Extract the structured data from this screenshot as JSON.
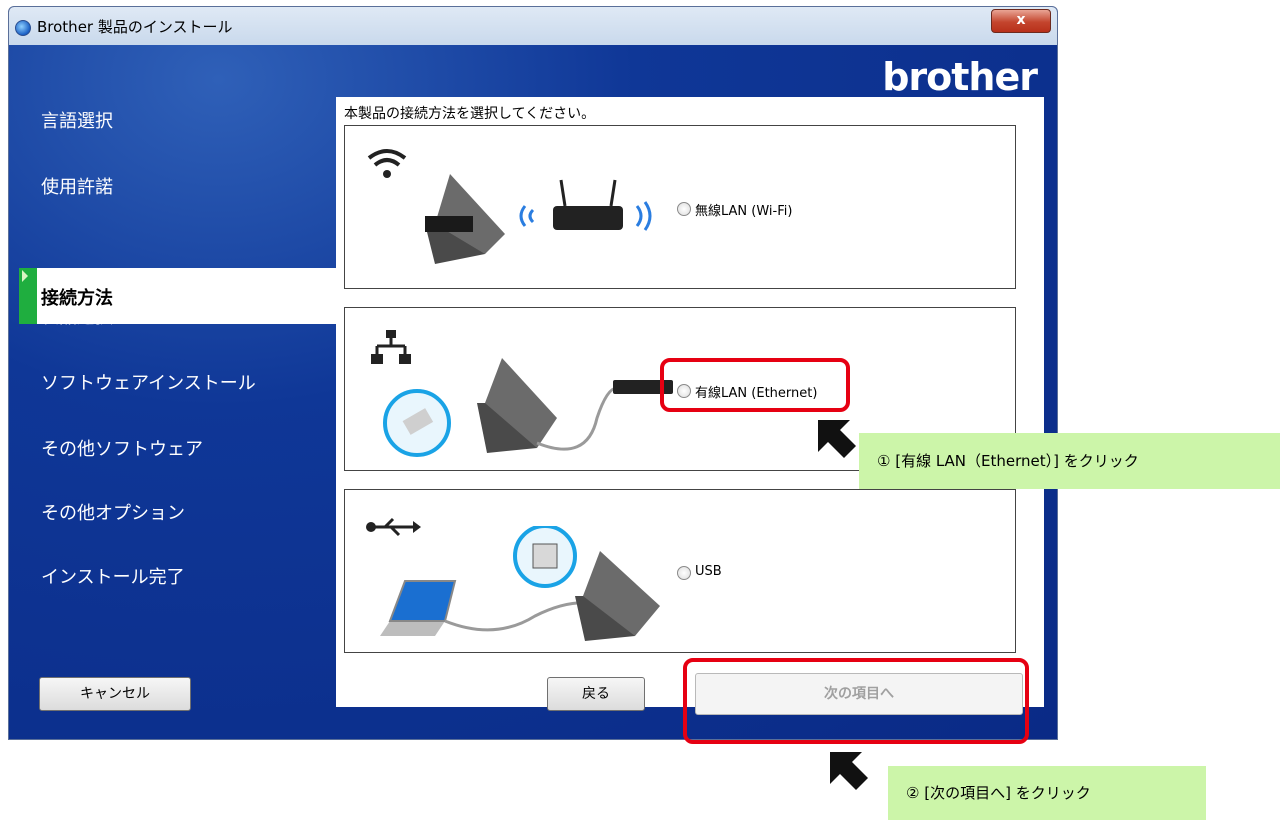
{
  "window": {
    "title": "Brother 製品のインストール",
    "close_label": "x"
  },
  "brand": {
    "logo_text": "brother"
  },
  "sidebar": {
    "items": [
      {
        "label": "言語選択"
      },
      {
        "label": "使用許諾"
      },
      {
        "label": "接続方法",
        "active": true
      },
      {
        "label": "製品選択"
      },
      {
        "label": "ソフトウェアインストール"
      },
      {
        "label": "その他ソフトウェア"
      },
      {
        "label": "その他オプション"
      },
      {
        "label": "インストール完了"
      }
    ]
  },
  "main": {
    "instruction": "本製品の接続方法を選択してください。",
    "options": [
      {
        "label": "無線LAN (Wi-Fi)",
        "icon": "wifi-icon",
        "selected": false
      },
      {
        "label": "有線LAN (Ethernet)",
        "icon": "network-icon",
        "selected": false
      },
      {
        "label": "USB",
        "icon": "usb-icon",
        "selected": false
      }
    ]
  },
  "footer": {
    "cancel_label": "キャンセル",
    "back_label": "戻る",
    "next_label": "次の項目へ",
    "next_enabled": false
  },
  "annotations": {
    "step1": "① [有線 LAN（Ethernet）] をクリック",
    "step2": "② [次の項目へ] をクリック"
  },
  "colors": {
    "window_blue": "#0a2d8c",
    "active_green": "#1fae3f",
    "highlight_red": "#e60012",
    "callout_green": "#ccf5a9"
  }
}
